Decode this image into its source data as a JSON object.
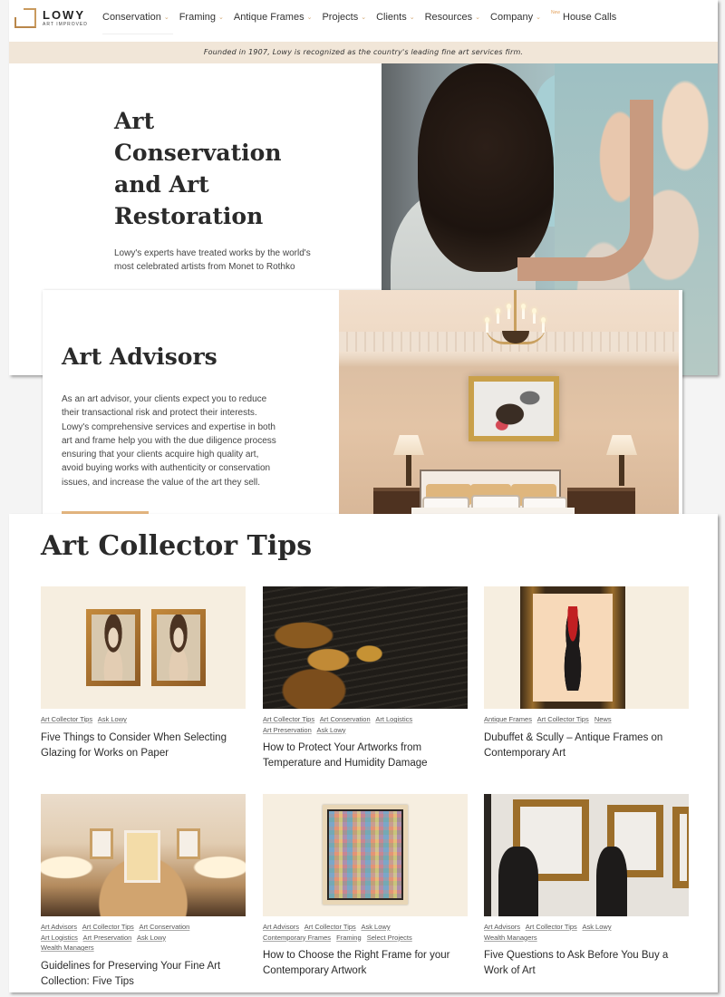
{
  "header": {
    "logo_name": "LOWY",
    "logo_tagline": "ART IMPROVED",
    "nav": [
      {
        "label": "Conservation",
        "has_dropdown": true
      },
      {
        "label": "Framing",
        "has_dropdown": true
      },
      {
        "label": "Antique Frames",
        "has_dropdown": true
      },
      {
        "label": "Projects",
        "has_dropdown": true
      },
      {
        "label": "Clients",
        "has_dropdown": true
      },
      {
        "label": "Resources",
        "has_dropdown": true
      },
      {
        "label": "Company",
        "has_dropdown": true
      }
    ],
    "house_calls": {
      "badge": "New",
      "label": "House Calls"
    },
    "caret_icon": "chevron-down-icon",
    "announcement": "Founded in 1907, Lowy is recognized as the country's leading fine art services firm.",
    "accent_color": "#d4a872"
  },
  "hero": {
    "title": "Art Conservation and Art Restoration",
    "description": "Lowy's experts have treated works by the world's most celebrated artists from Monet to Rothko",
    "image_alt": "Conservator restoring a mural painting"
  },
  "advisors": {
    "title": "Art Advisors",
    "description": "As an art advisor, your clients expect you to reduce their transactional risk and protect their interests. Lowy's comprehensive services and expertise in both art and frame help you with the due diligence process ensuring that your clients acquire high quality art, avoid buying works with authenticity or conservation issues, and increase the value of the art they sell.",
    "button_color": "#e2b47e",
    "image_alt": "Bedroom with framed abstract painting above bed"
  },
  "tips": {
    "title": "Art Collector Tips",
    "cards": [
      {
        "tags": [
          "Art Collector Tips",
          "Ask Lowy"
        ],
        "title": "Five Things to Consider When Selecting Glazing for Works on Paper",
        "image_alt": "Two framed portraits side by side"
      },
      {
        "tags": [
          "Art Collector Tips",
          "Art Conservation",
          "Art Logistics",
          "Art Preservation",
          "Ask Lowy"
        ],
        "title": "How to Protect Your Artworks from Temperature and Humidity Damage",
        "image_alt": "Cracked lacquer panel close-up"
      },
      {
        "tags": [
          "Antique Frames",
          "Art Collector Tips",
          "News"
        ],
        "title": "Dubuffet & Scully – Antique Frames on Contemporary Art",
        "image_alt": "Dubuffet figure in antique frame"
      },
      {
        "tags": [
          "Art Advisors",
          "Art Collector Tips",
          "Art Conservation",
          "Art Logistics",
          "Art Preservation",
          "Ask Lowy",
          "Wealth Managers"
        ],
        "title": "Guidelines for Preserving Your Fine Art Collection: Five Tips",
        "image_alt": "Living room with framed artworks"
      },
      {
        "tags": [
          "Art Advisors",
          "Art Collector Tips",
          "Ask Lowy",
          "Contemporary Frames",
          "Framing",
          "Select Projects"
        ],
        "title": "How to Choose the Right Frame for your Contemporary Artwork",
        "image_alt": "Colorful abstract painting in frame"
      },
      {
        "tags": [
          "Art Advisors",
          "Art Collector Tips",
          "Ask Lowy",
          "Wealth Managers"
        ],
        "title": "Five Questions to Ask Before You Buy a Work of Art",
        "image_alt": "People in gallery with gilded frames"
      }
    ]
  }
}
